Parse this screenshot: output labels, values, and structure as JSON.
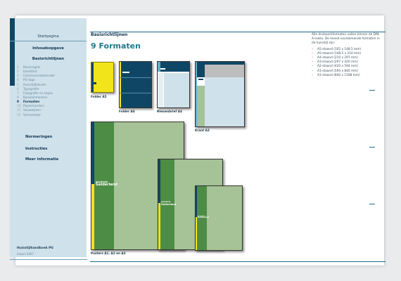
{
  "sidebar": {
    "home": "Startpagina",
    "contents": "Inhoudsopgave",
    "section_heading": "Basisrichtlijnen",
    "items": [
      {
        "num": "1",
        "label": "Basisregels"
      },
      {
        "num": "2",
        "label": "Identiteit"
      },
      {
        "num": "3",
        "label": "Communicatiemodel"
      },
      {
        "num": "4",
        "label": "PG-logo"
      },
      {
        "num": "5",
        "label": "Huisstijlkleuren"
      },
      {
        "num": "6",
        "label": "Typografie"
      },
      {
        "num": "7",
        "label": "Fotografie en tegen"
      },
      {
        "num": "8",
        "label": "Basiselementen"
      },
      {
        "num": "9",
        "label": "Formaten"
      },
      {
        "num": "10",
        "label": "Papiersoorten"
      },
      {
        "num": "11",
        "label": "Vouwwijzen"
      },
      {
        "num": "12",
        "label": "Vormentaal"
      }
    ],
    "active_index": 8,
    "links": [
      "Normeringen",
      "Instructies",
      "Meer informatie"
    ],
    "footer_title": "Huisstijlhandboek PG",
    "footer_sub": "maart 2007"
  },
  "header": {
    "section": "Basisrichtlijnen",
    "title": "9  Formaten"
  },
  "intro": {
    "text": "Alle drukwerkformaten vallen binnen de DIN-A-reeks. De meest voorkomende formaten in de huisstijl zijn:",
    "formats": [
      "A5-staand (105 x 148,5 mm)",
      "A5-staand (148,5 x 210 mm)",
      "A4-staand (210 x 297 mm)",
      "A3-staand (297 x 420 mm)",
      "A2-staand (420 x 594 mm)",
      "A1-staand (594 x 840 mm)",
      "A1-staand (840 x 1188 mm)"
    ]
  },
  "captions": {
    "folder_a5": "Folder A5",
    "folder_a4": "Folder A4",
    "nieuwsbrief_a4": "Nieuwsbrief A4",
    "krant_a3": "Krant A3",
    "posters": "Posters A1, A2 en A3"
  },
  "poster_logo": {
    "line1": "provincie",
    "line2": "Gelderland"
  },
  "colors": {
    "navy": "#0f4666",
    "sidebar_bg": "#cfe1ea",
    "green_dark": "#4d8c45",
    "green_light": "#a5c396",
    "yellow": "#f2e41b",
    "teal": "#1f7a8c"
  }
}
